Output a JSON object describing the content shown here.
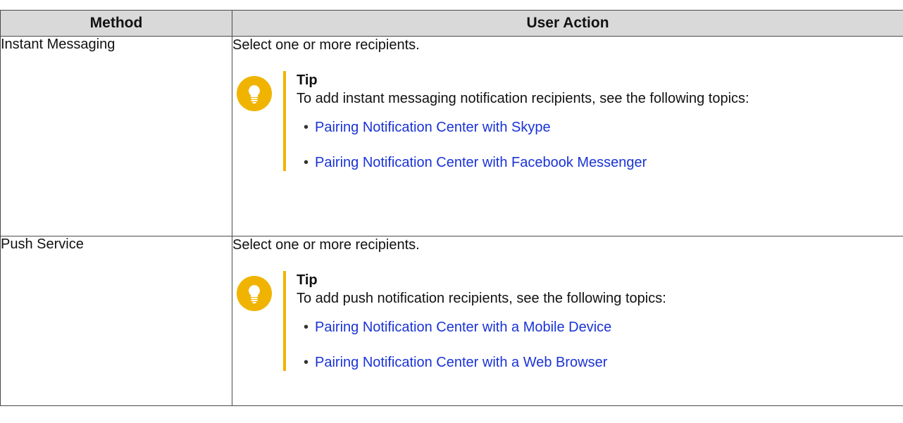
{
  "table": {
    "headers": [
      "Method",
      "User Action"
    ],
    "rows": [
      {
        "method": "Instant Messaging",
        "action": "Select one or more recipients.",
        "tip": {
          "title": "Tip",
          "text": "To add instant messaging notification recipients, see the following topics:",
          "links": [
            "Pairing Notification Center with Skype",
            "Pairing Notification Center with Facebook Messenger"
          ]
        }
      },
      {
        "method": "Push Service",
        "action": "Select one or more recipients.",
        "tip": {
          "title": "Tip",
          "text": "To add push notification recipients, see the following topics:",
          "links": [
            "Pairing Notification Center with a Mobile Device",
            "Pairing Notification Center with a Web Browser"
          ]
        }
      }
    ]
  },
  "colors": {
    "tip_accent": "#f0b400",
    "link": "#1a33d6",
    "header_bg": "#d9d9d9"
  },
  "icons": {
    "tip": "lightbulb-icon",
    "bullet": "•"
  }
}
